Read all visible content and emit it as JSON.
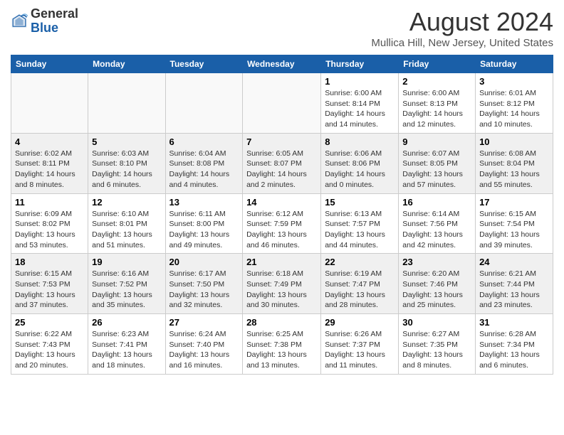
{
  "logo": {
    "general": "General",
    "blue": "Blue"
  },
  "title": "August 2024",
  "subtitle": "Mullica Hill, New Jersey, United States",
  "days_of_week": [
    "Sunday",
    "Monday",
    "Tuesday",
    "Wednesday",
    "Thursday",
    "Friday",
    "Saturday"
  ],
  "weeks": [
    [
      {
        "num": "",
        "sunrise": "",
        "sunset": "",
        "daylight": ""
      },
      {
        "num": "",
        "sunrise": "",
        "sunset": "",
        "daylight": ""
      },
      {
        "num": "",
        "sunrise": "",
        "sunset": "",
        "daylight": ""
      },
      {
        "num": "",
        "sunrise": "",
        "sunset": "",
        "daylight": ""
      },
      {
        "num": "1",
        "sunrise": "Sunrise: 6:00 AM",
        "sunset": "Sunset: 8:14 PM",
        "daylight": "Daylight: 14 hours and 14 minutes."
      },
      {
        "num": "2",
        "sunrise": "Sunrise: 6:00 AM",
        "sunset": "Sunset: 8:13 PM",
        "daylight": "Daylight: 14 hours and 12 minutes."
      },
      {
        "num": "3",
        "sunrise": "Sunrise: 6:01 AM",
        "sunset": "Sunset: 8:12 PM",
        "daylight": "Daylight: 14 hours and 10 minutes."
      }
    ],
    [
      {
        "num": "4",
        "sunrise": "Sunrise: 6:02 AM",
        "sunset": "Sunset: 8:11 PM",
        "daylight": "Daylight: 14 hours and 8 minutes."
      },
      {
        "num": "5",
        "sunrise": "Sunrise: 6:03 AM",
        "sunset": "Sunset: 8:10 PM",
        "daylight": "Daylight: 14 hours and 6 minutes."
      },
      {
        "num": "6",
        "sunrise": "Sunrise: 6:04 AM",
        "sunset": "Sunset: 8:08 PM",
        "daylight": "Daylight: 14 hours and 4 minutes."
      },
      {
        "num": "7",
        "sunrise": "Sunrise: 6:05 AM",
        "sunset": "Sunset: 8:07 PM",
        "daylight": "Daylight: 14 hours and 2 minutes."
      },
      {
        "num": "8",
        "sunrise": "Sunrise: 6:06 AM",
        "sunset": "Sunset: 8:06 PM",
        "daylight": "Daylight: 14 hours and 0 minutes."
      },
      {
        "num": "9",
        "sunrise": "Sunrise: 6:07 AM",
        "sunset": "Sunset: 8:05 PM",
        "daylight": "Daylight: 13 hours and 57 minutes."
      },
      {
        "num": "10",
        "sunrise": "Sunrise: 6:08 AM",
        "sunset": "Sunset: 8:04 PM",
        "daylight": "Daylight: 13 hours and 55 minutes."
      }
    ],
    [
      {
        "num": "11",
        "sunrise": "Sunrise: 6:09 AM",
        "sunset": "Sunset: 8:02 PM",
        "daylight": "Daylight: 13 hours and 53 minutes."
      },
      {
        "num": "12",
        "sunrise": "Sunrise: 6:10 AM",
        "sunset": "Sunset: 8:01 PM",
        "daylight": "Daylight: 13 hours and 51 minutes."
      },
      {
        "num": "13",
        "sunrise": "Sunrise: 6:11 AM",
        "sunset": "Sunset: 8:00 PM",
        "daylight": "Daylight: 13 hours and 49 minutes."
      },
      {
        "num": "14",
        "sunrise": "Sunrise: 6:12 AM",
        "sunset": "Sunset: 7:59 PM",
        "daylight": "Daylight: 13 hours and 46 minutes."
      },
      {
        "num": "15",
        "sunrise": "Sunrise: 6:13 AM",
        "sunset": "Sunset: 7:57 PM",
        "daylight": "Daylight: 13 hours and 44 minutes."
      },
      {
        "num": "16",
        "sunrise": "Sunrise: 6:14 AM",
        "sunset": "Sunset: 7:56 PM",
        "daylight": "Daylight: 13 hours and 42 minutes."
      },
      {
        "num": "17",
        "sunrise": "Sunrise: 6:15 AM",
        "sunset": "Sunset: 7:54 PM",
        "daylight": "Daylight: 13 hours and 39 minutes."
      }
    ],
    [
      {
        "num": "18",
        "sunrise": "Sunrise: 6:15 AM",
        "sunset": "Sunset: 7:53 PM",
        "daylight": "Daylight: 13 hours and 37 minutes."
      },
      {
        "num": "19",
        "sunrise": "Sunrise: 6:16 AM",
        "sunset": "Sunset: 7:52 PM",
        "daylight": "Daylight: 13 hours and 35 minutes."
      },
      {
        "num": "20",
        "sunrise": "Sunrise: 6:17 AM",
        "sunset": "Sunset: 7:50 PM",
        "daylight": "Daylight: 13 hours and 32 minutes."
      },
      {
        "num": "21",
        "sunrise": "Sunrise: 6:18 AM",
        "sunset": "Sunset: 7:49 PM",
        "daylight": "Daylight: 13 hours and 30 minutes."
      },
      {
        "num": "22",
        "sunrise": "Sunrise: 6:19 AM",
        "sunset": "Sunset: 7:47 PM",
        "daylight": "Daylight: 13 hours and 28 minutes."
      },
      {
        "num": "23",
        "sunrise": "Sunrise: 6:20 AM",
        "sunset": "Sunset: 7:46 PM",
        "daylight": "Daylight: 13 hours and 25 minutes."
      },
      {
        "num": "24",
        "sunrise": "Sunrise: 6:21 AM",
        "sunset": "Sunset: 7:44 PM",
        "daylight": "Daylight: 13 hours and 23 minutes."
      }
    ],
    [
      {
        "num": "25",
        "sunrise": "Sunrise: 6:22 AM",
        "sunset": "Sunset: 7:43 PM",
        "daylight": "Daylight: 13 hours and 20 minutes."
      },
      {
        "num": "26",
        "sunrise": "Sunrise: 6:23 AM",
        "sunset": "Sunset: 7:41 PM",
        "daylight": "Daylight: 13 hours and 18 minutes."
      },
      {
        "num": "27",
        "sunrise": "Sunrise: 6:24 AM",
        "sunset": "Sunset: 7:40 PM",
        "daylight": "Daylight: 13 hours and 16 minutes."
      },
      {
        "num": "28",
        "sunrise": "Sunrise: 6:25 AM",
        "sunset": "Sunset: 7:38 PM",
        "daylight": "Daylight: 13 hours and 13 minutes."
      },
      {
        "num": "29",
        "sunrise": "Sunrise: 6:26 AM",
        "sunset": "Sunset: 7:37 PM",
        "daylight": "Daylight: 13 hours and 11 minutes."
      },
      {
        "num": "30",
        "sunrise": "Sunrise: 6:27 AM",
        "sunset": "Sunset: 7:35 PM",
        "daylight": "Daylight: 13 hours and 8 minutes."
      },
      {
        "num": "31",
        "sunrise": "Sunrise: 6:28 AM",
        "sunset": "Sunset: 7:34 PM",
        "daylight": "Daylight: 13 hours and 6 minutes."
      }
    ]
  ]
}
